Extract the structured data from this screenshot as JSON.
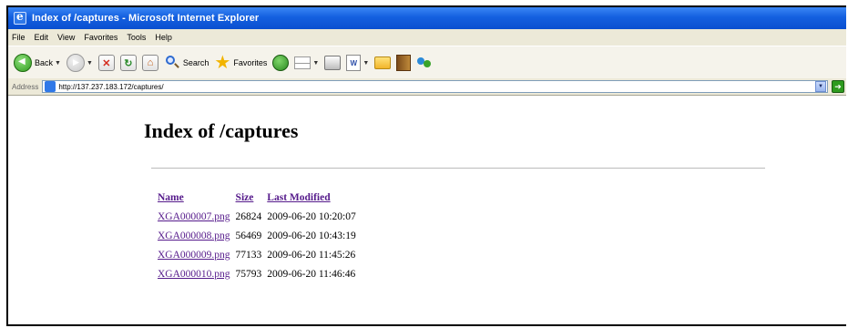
{
  "window": {
    "title": "Index of /captures - Microsoft Internet Explorer"
  },
  "menu": {
    "items": [
      "File",
      "Edit",
      "View",
      "Favorites",
      "Tools",
      "Help"
    ]
  },
  "toolbar": {
    "back_label": "Back",
    "search_label": "Search",
    "favorites_label": "Favorites"
  },
  "address": {
    "label": "Address",
    "value": "http://137.237.183.172/captures/"
  },
  "page": {
    "heading": "Index of /captures",
    "columns": {
      "name": "Name",
      "size": "Size",
      "modified": "Last Modified"
    },
    "files": [
      {
        "name": "XGA000007.png",
        "size": "26824",
        "modified": "2009-06-20 10:20:07"
      },
      {
        "name": "XGA000008.png",
        "size": "56469",
        "modified": "2009-06-20 10:43:19"
      },
      {
        "name": "XGA000009.png",
        "size": "77133",
        "modified": "2009-06-20 11:45:26"
      },
      {
        "name": "XGA000010.png",
        "size": "75793",
        "modified": "2009-06-20 11:46:46"
      }
    ]
  }
}
